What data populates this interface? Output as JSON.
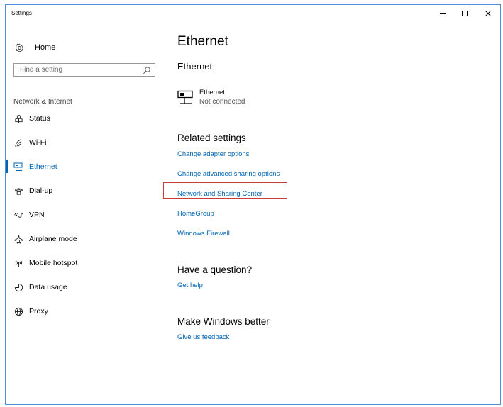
{
  "window": {
    "title": "Settings",
    "minimize_glyph": "–",
    "maximize_glyph": "□",
    "close_glyph": "×"
  },
  "sidebar": {
    "home_label": "Home",
    "search_placeholder": "Find a setting",
    "section_label": "Network & Internet",
    "items": [
      {
        "label": "Status",
        "icon": "status-icon"
      },
      {
        "label": "Wi-Fi",
        "icon": "wifi-icon"
      },
      {
        "label": "Ethernet",
        "icon": "ethernet-icon",
        "active": true
      },
      {
        "label": "Dial-up",
        "icon": "dialup-icon"
      },
      {
        "label": "VPN",
        "icon": "vpn-icon"
      },
      {
        "label": "Airplane mode",
        "icon": "airplane-icon"
      },
      {
        "label": "Mobile hotspot",
        "icon": "hotspot-icon"
      },
      {
        "label": "Data usage",
        "icon": "data-usage-icon"
      },
      {
        "label": "Proxy",
        "icon": "proxy-icon"
      }
    ]
  },
  "main": {
    "title": "Ethernet",
    "subtitle": "Ethernet",
    "connection": {
      "name": "Ethernet",
      "status": "Not connected"
    },
    "related_heading": "Related settings",
    "related_links": [
      "Change adapter options",
      "Change advanced sharing options",
      "Network and Sharing Center",
      "HomeGroup",
      "Windows Firewall"
    ],
    "question_heading": "Have a question?",
    "question_link": "Get help",
    "feedback_heading": "Make Windows better",
    "feedback_link": "Give us feedback"
  },
  "colors": {
    "accent": "#0063b1",
    "window_border": "#4a8fd6",
    "highlight_border": "#c93a3a"
  }
}
